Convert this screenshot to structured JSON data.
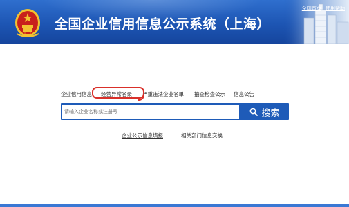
{
  "header": {
    "title": "全国企业信用信息公示系统（上海）",
    "emblem_icon": "national-emblem-icon",
    "top_links": [
      "全国首页",
      "使用帮助"
    ]
  },
  "tabs": [
    {
      "label": "企业信用信息"
    },
    {
      "label": "经营异常名录",
      "highlighted": true
    },
    {
      "label": "严重违法企业名单"
    },
    {
      "label": "抽查检查公示"
    },
    {
      "label": "信息公告"
    }
  ],
  "search": {
    "placeholder": "请输入企业名称或注册号",
    "button_label": "搜索",
    "button_icon": "search-icon"
  },
  "bottom_links": [
    "企业公示信息填报",
    "相关部门信息交换"
  ],
  "colors": {
    "header_blue": "#1d55b3",
    "search_blue": "#1e5bb8",
    "highlight_red": "#d9302a",
    "emblem_red": "#c8201c",
    "emblem_gold": "#f2c230"
  }
}
